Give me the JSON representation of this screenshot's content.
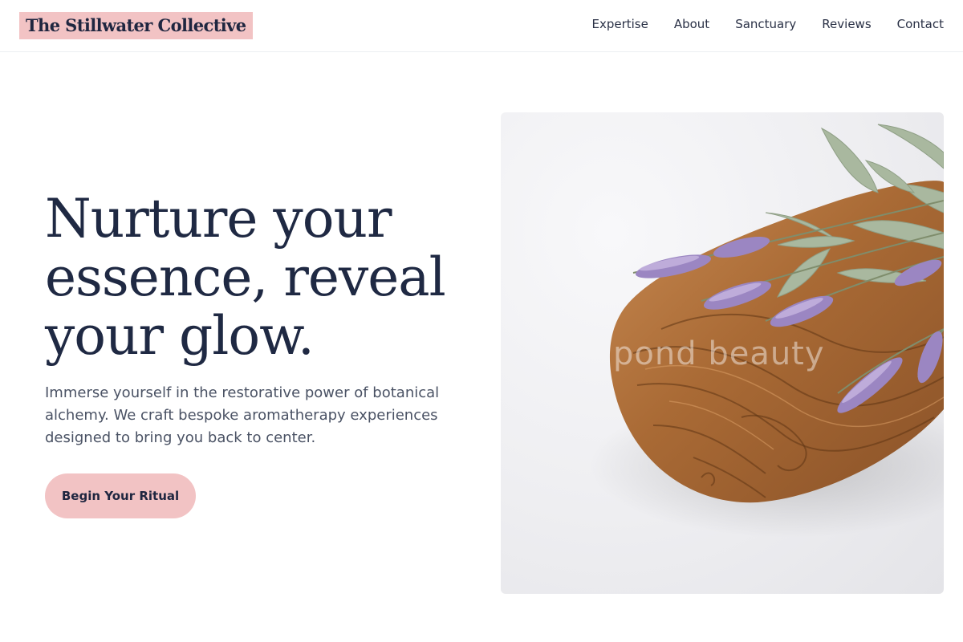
{
  "header": {
    "brand": "The Stillwater Collective",
    "nav": [
      "Expertise",
      "About",
      "Sanctuary",
      "Reviews",
      "Contact"
    ]
  },
  "hero": {
    "title": "Nurture your essence, reveal your glow.",
    "description": "Immerse yourself in the restorative power of botanical alchemy. We craft bespoke aromatherapy experiences designed to bring you back to center.",
    "cta_label": "Begin Your Ritual",
    "image": {
      "subject": "olive-wood-board-with-lavender",
      "watermark": "pond beauty"
    }
  },
  "colors": {
    "accent": "#f2c3c4",
    "heading": "#1f2943",
    "body_text": "#4a5264",
    "nav_text": "#2a3146"
  }
}
